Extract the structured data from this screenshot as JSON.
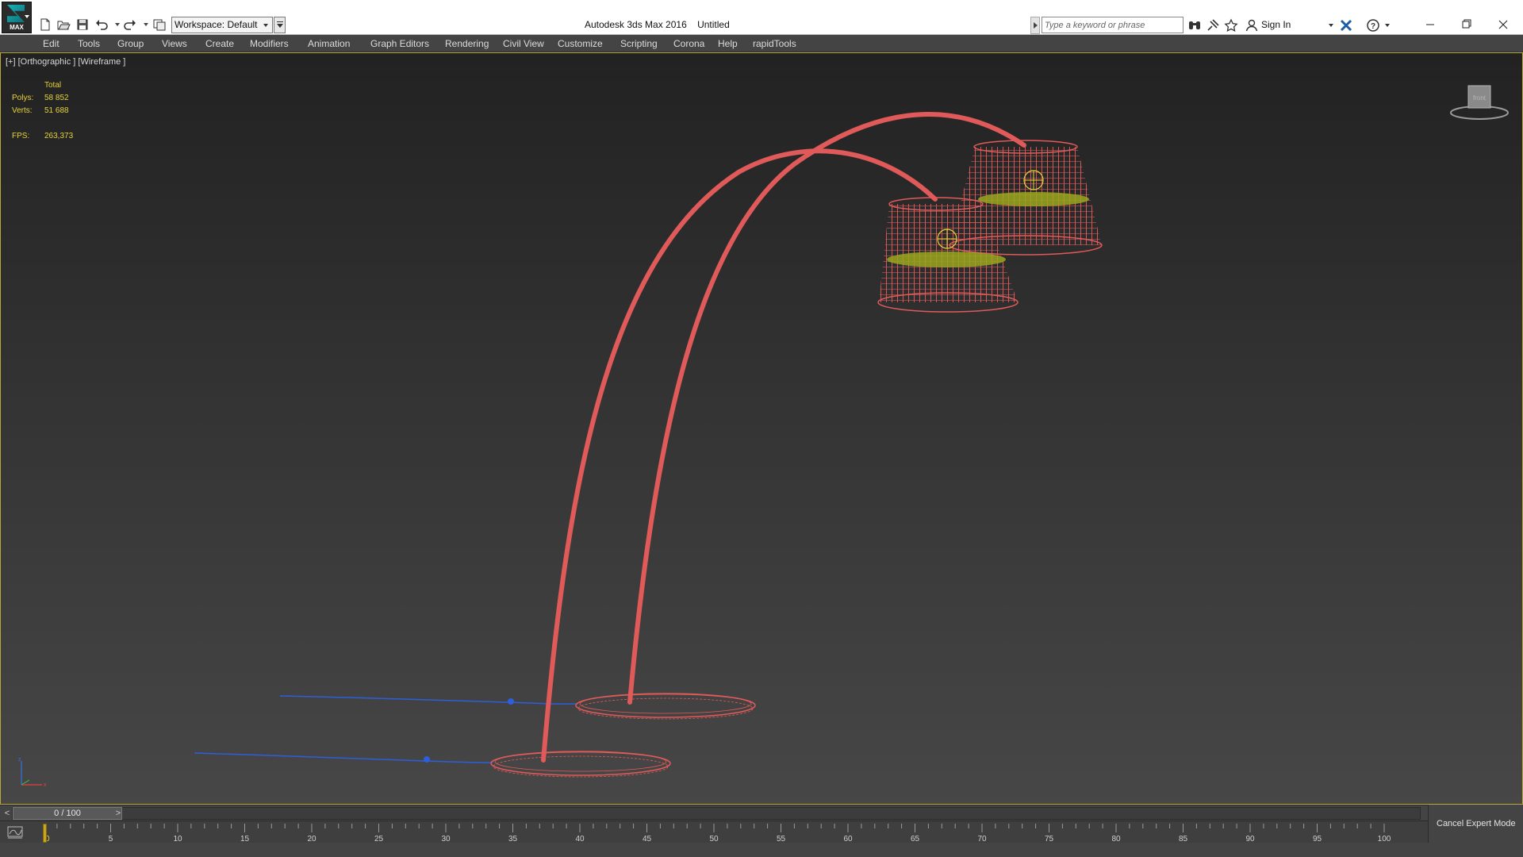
{
  "window": {
    "title": "Autodesk 3ds Max 2016    Untitled",
    "logo_text": "MAX",
    "workspace": "Workspace: Default",
    "search_placeholder": "Type a keyword or phrase",
    "sign_in": "Sign In"
  },
  "menu": [
    {
      "label": "Edit"
    },
    {
      "label": "Tools"
    },
    {
      "label": "Group"
    },
    {
      "label": "Views"
    },
    {
      "label": "Create"
    },
    {
      "label": "Modifiers"
    },
    {
      "label": "Animation"
    },
    {
      "label": "Graph Editors"
    },
    {
      "label": "Rendering"
    },
    {
      "label": "Civil View"
    },
    {
      "label": "Customize"
    },
    {
      "label": "Scripting"
    },
    {
      "label": "Corona"
    },
    {
      "label": "Help"
    },
    {
      "label": "rapidTools"
    }
  ],
  "viewport": {
    "label": "[+] [Orthographic ] [Wireframe ]",
    "stats": {
      "header": "Total",
      "polys_label": "Polys:",
      "polys": "58 852",
      "verts_label": "Verts:",
      "verts": "51 688",
      "fps_label": "FPS:",
      "fps": "263,373"
    },
    "viewcube_label": "front",
    "axis": {
      "z": "z",
      "x": "x"
    }
  },
  "timeline": {
    "frame_display": "0 / 100",
    "prev": "<",
    "next": ">",
    "ticks": [
      "0",
      "5",
      "10",
      "15",
      "20",
      "25",
      "30",
      "35",
      "40",
      "45",
      "50",
      "55",
      "60",
      "65",
      "70",
      "75",
      "80",
      "85",
      "90",
      "95",
      "100"
    ]
  },
  "status": {
    "cancel_expert": "Cancel Expert Mode"
  },
  "colors": {
    "wire_red": "#e05a5a",
    "spline_blue": "#2e5fd8",
    "light_green": "#9aa61e",
    "stat_yellow": "#e6d23a",
    "viewport_border": "#b8a93a"
  }
}
